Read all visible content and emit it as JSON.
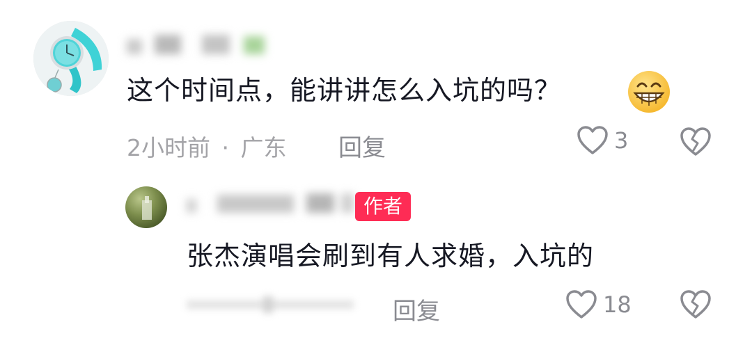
{
  "comment": {
    "username": "",
    "text": "这个时间点，能讲讲怎么入坑的吗？",
    "time": "2小时前",
    "separator": "·",
    "location": "广东",
    "reply_label": "回复",
    "like_count": "3"
  },
  "reply": {
    "username": "",
    "badge": "作者",
    "text": "张杰演唱会刷到有人求婚，入坑的",
    "reply_label": "回复",
    "like_count": "18"
  },
  "icons": {
    "like": "heart-outline-icon",
    "dislike": "broken-heart-icon",
    "emoji": "grin-emoji-icon"
  },
  "colors": {
    "badge": "#fe2c55",
    "text": "#161823",
    "meta": "#a3a3a7"
  }
}
